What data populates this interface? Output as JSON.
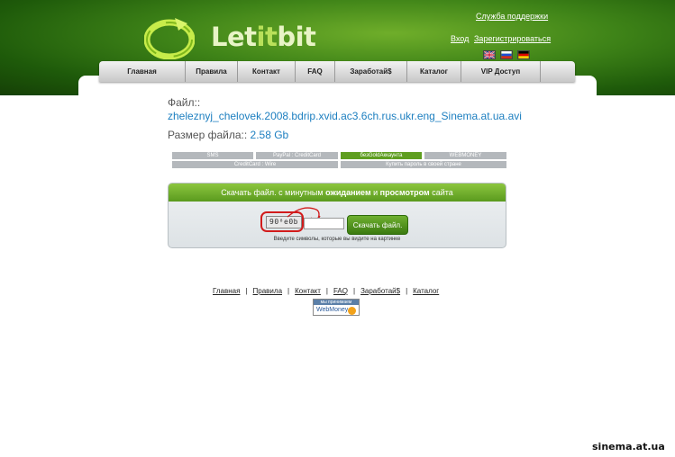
{
  "header": {
    "logo_text_prefix": "Let",
    "logo_text_mid": "it",
    "logo_text_suffix": "bit",
    "support_link": "Служба поддержки",
    "login_link": "Вход",
    "register_link": "Зарегистрироваться",
    "languages": [
      "uk-flag-icon",
      "ru-flag-icon",
      "de-flag-icon"
    ]
  },
  "nav": {
    "items": [
      {
        "label": "Главная"
      },
      {
        "label": "Правила"
      },
      {
        "label": "Контакт"
      },
      {
        "label": "FAQ"
      },
      {
        "label": "Заработай$"
      },
      {
        "label": "Каталог"
      },
      {
        "label": "VIP Доступ"
      }
    ]
  },
  "file": {
    "label": "Файл::",
    "name": "zheleznyj_chelovek.2008.bdrip.xvid.ac3.6ch.rus.ukr.eng_Sinema.at.ua.avi",
    "size_label": "Размер файла::",
    "size_value": "2.58 Gb"
  },
  "payment_tabs": {
    "sms": "SMS",
    "paypal": "PayPal : CreditCard",
    "gold": "безGoldАккаунта",
    "webmoney": "WEBMONEY",
    "creditcard_wire": "CreditCard : Wire",
    "buy_password": "Купить пароль в своей стране"
  },
  "download": {
    "head_prefix": "Скачать файл.  с минутным ",
    "head_wait": "ожиданием",
    "head_and": " и ",
    "head_view": "просмотром",
    "head_suffix": " сайта",
    "captcha_text": "90⁸e0b",
    "captcha_value": "",
    "button_label": "Скачать файл.",
    "hint": "Введите символы, которые вы видите на картинке"
  },
  "footer": {
    "links": [
      "Главная",
      "Правила",
      "Контакт",
      "FAQ",
      "Заработай$",
      "Каталог"
    ],
    "separator": "|",
    "wm_top": "мы принимаем",
    "wm_bottom": "WebMoney"
  },
  "watermark": "sinema.at.ua",
  "colors": {
    "brand_green": "#5a9a1e",
    "link_blue": "#1d7fc0",
    "captcha_ring": "#d21c1c"
  }
}
